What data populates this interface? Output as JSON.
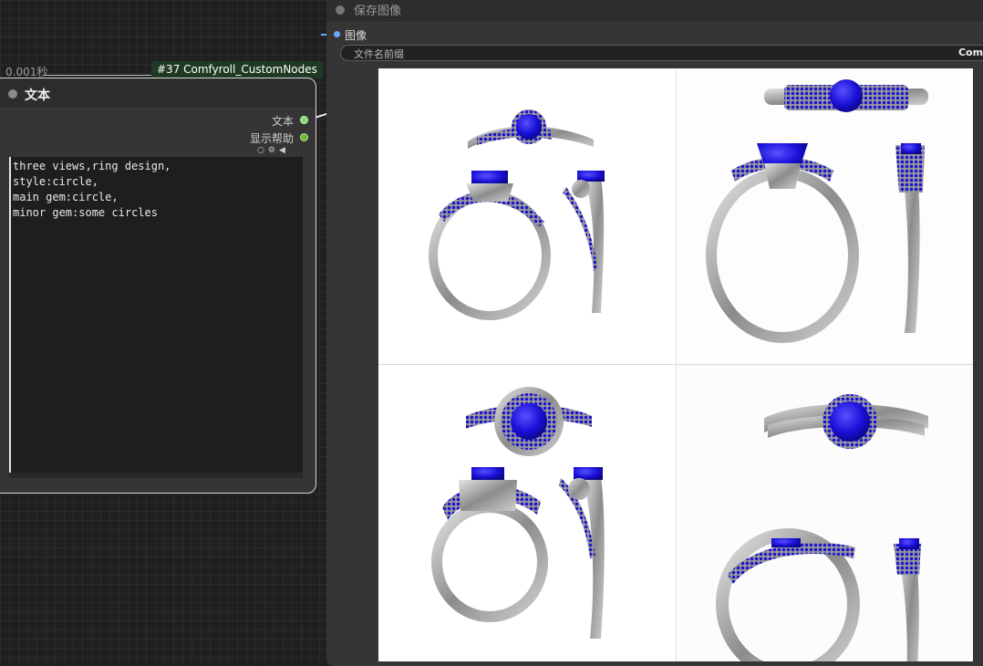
{
  "text_node": {
    "timing": "0.001秒",
    "badge": "#37 Comfyroll_CustomNodes",
    "title": "文本",
    "outputs": [
      {
        "label": "文本"
      },
      {
        "label": "显示帮助"
      }
    ],
    "icons": [
      "radio-icon",
      "gear-icon",
      "speaker-icon"
    ],
    "text_value": "three views,ring design,\nstyle:circle,\nmain gem:circle,\nminor gem:some circles"
  },
  "save_node": {
    "title": "保存图像",
    "input_label": "图像",
    "prefix_label": "文件名前缀",
    "prefix_value": "Comfy"
  },
  "preview": {
    "tiles": [
      {
        "name": "ring-sheet-top-left"
      },
      {
        "name": "ring-sheet-top-right"
      },
      {
        "name": "ring-sheet-bottom-left"
      },
      {
        "name": "ring-sheet-bottom-right"
      }
    ]
  },
  "colors": {
    "gem": "#1a10d8",
    "metal": "#a6a6a6",
    "output_text": "#7be06b",
    "output_help": "#6fb834",
    "input_image": "#6aa7ff",
    "badge_bg": "#1f3a24"
  }
}
